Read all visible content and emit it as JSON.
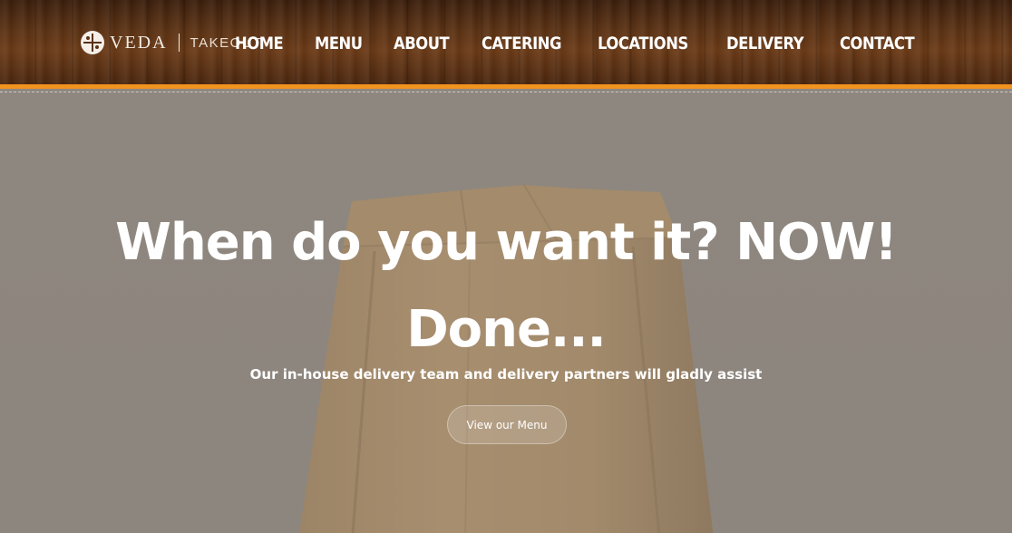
{
  "header": {
    "logo": {
      "brand": "VEDA",
      "sub": "TAKEOUT",
      "icon": "veda-emblem-icon"
    },
    "nav": [
      {
        "label": "HOME"
      },
      {
        "label": "MENU"
      },
      {
        "label": "ABOUT"
      },
      {
        "label": "CATERING"
      },
      {
        "label": "LOCATIONS"
      },
      {
        "label": "DELIVERY"
      },
      {
        "label": "CONTACT"
      }
    ],
    "accent_color": "#f0931f"
  },
  "hero": {
    "title_line1": "When do you want it? NOW!",
    "title_line2": "Done...",
    "subtitle": "Our in-house delivery team and delivery partners will gladly assist",
    "button_label": "View our Menu",
    "background_image": "paper-bag"
  }
}
